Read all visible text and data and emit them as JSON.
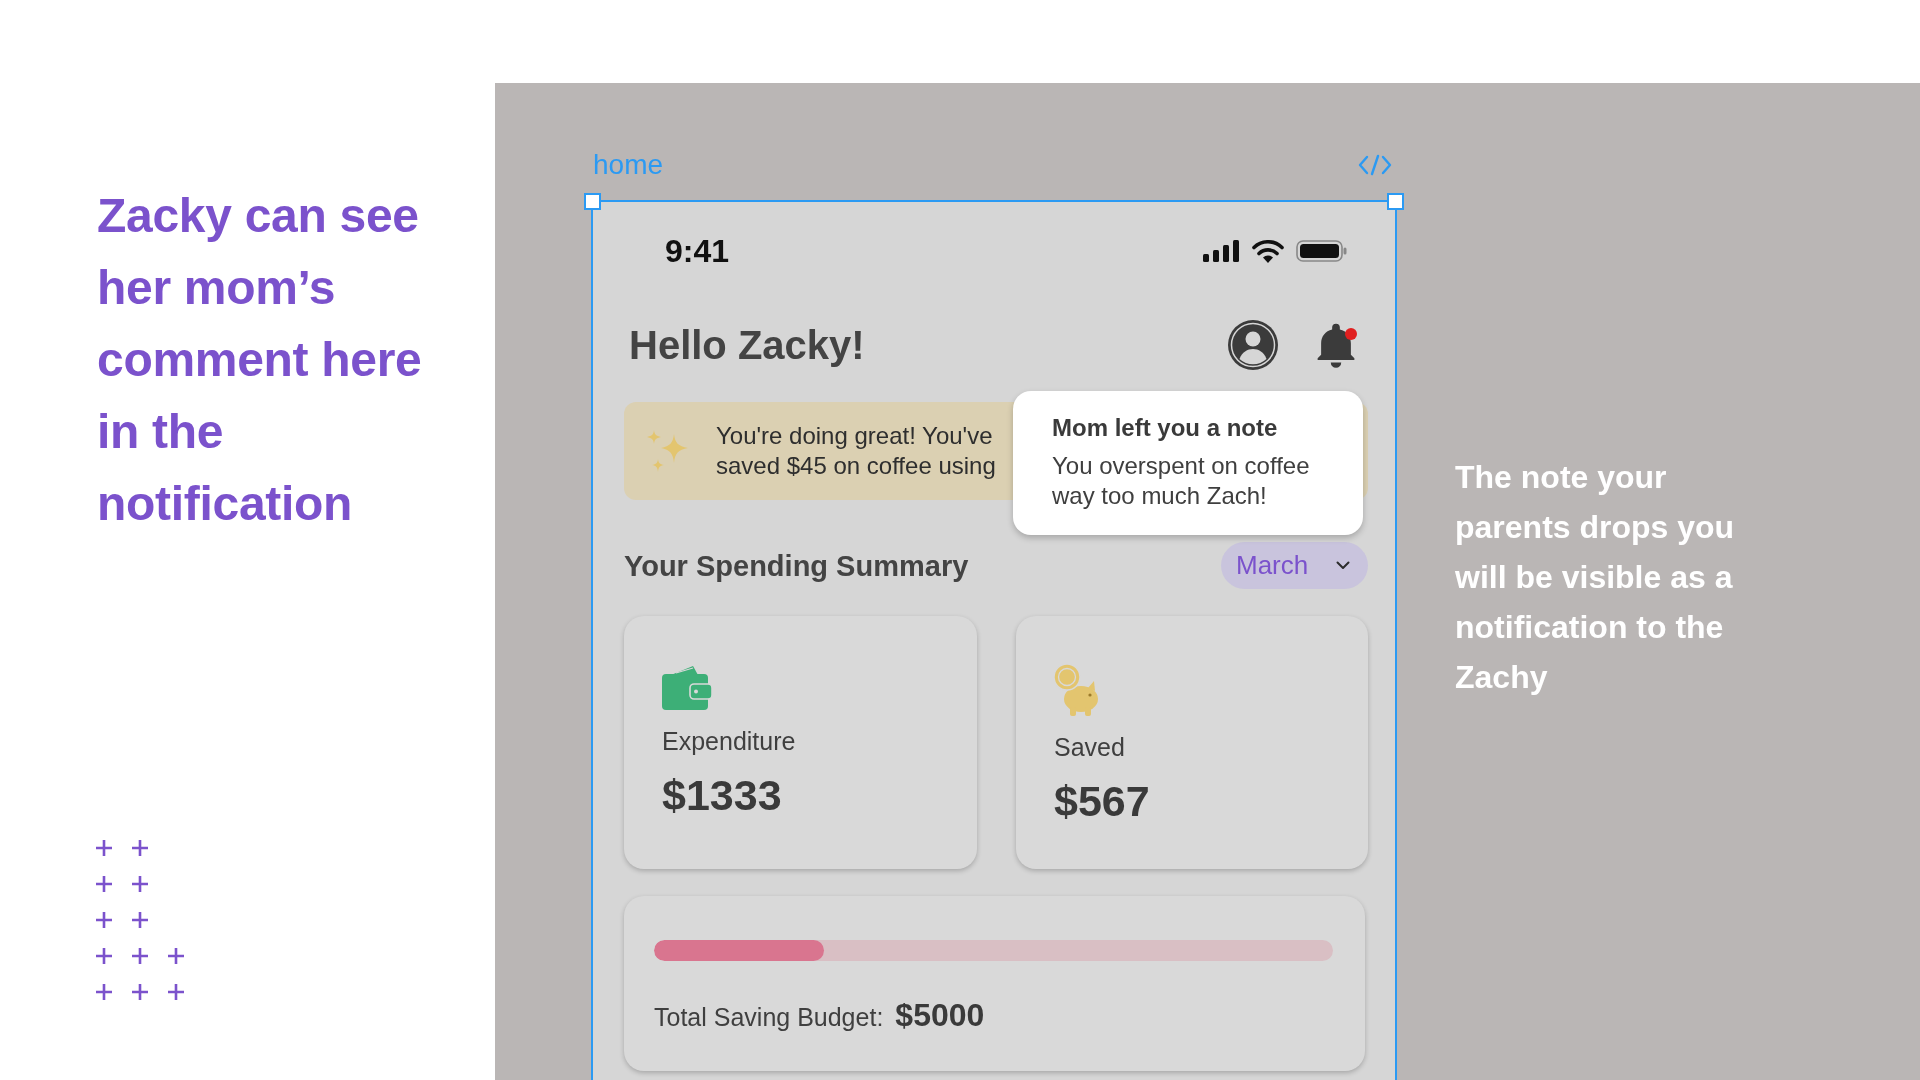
{
  "annotation_left": {
    "lines": [
      "Zacky can see",
      "her mom’s",
      "comment here",
      "in the",
      "notification"
    ]
  },
  "frame": {
    "label": "home"
  },
  "status_bar": {
    "time": "9:41"
  },
  "header": {
    "greeting": "Hello Zacky!",
    "notifications_unread": true
  },
  "banner": {
    "lines": [
      "You're doing great! You've",
      "saved $45 on coffee using"
    ]
  },
  "notification": {
    "title": "Mom left you a note",
    "lines": [
      "You overspent on coffee",
      "way too much Zach!"
    ]
  },
  "summary": {
    "title": "Your Spending Summary",
    "month": "March"
  },
  "cards": [
    {
      "kind": "expenditure",
      "label": "Expenditure",
      "amount": "$1333"
    },
    {
      "kind": "saved",
      "label": "Saved",
      "amount": "$567"
    }
  ],
  "budget": {
    "level": 0.25,
    "label": "Total Saving Budget:",
    "amount": "$5000"
  },
  "annotation_right": {
    "lines": [
      "The note your",
      "parents drops you",
      "will be visible as a",
      "notification to the",
      "Zachy"
    ]
  }
}
